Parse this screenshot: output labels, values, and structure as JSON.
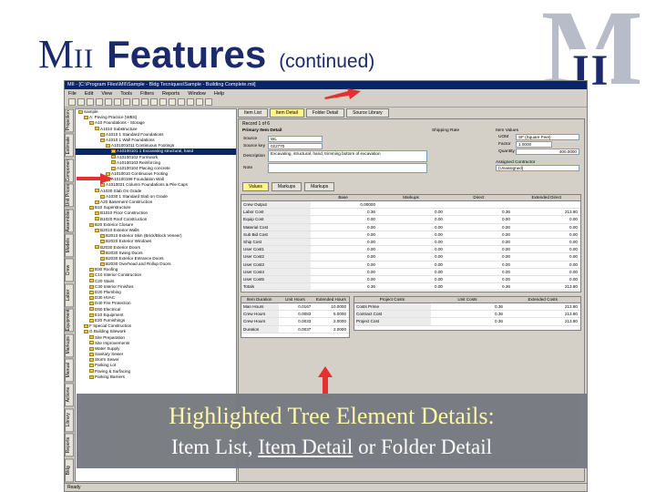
{
  "slide": {
    "title_m": "M",
    "title_ii": "II",
    "title_features": "Features",
    "title_continued": "(continued)",
    "logo_m": "M",
    "logo_ii": "II",
    "accent_color": "#1a2a6c",
    "arrow_color": "#e53030"
  },
  "app": {
    "window_title": "MII - [C:\\Program Files\\MII\\Sample - Bldg Tecniques\\Sample - Building Complete.mii]",
    "menu": [
      "File",
      "Edit",
      "View",
      "Tools",
      "Filters",
      "Reports",
      "Window",
      "Help"
    ],
    "left_tabs": [
      "Projection",
      "Estimate",
      "Components",
      "Unit Prices",
      "Assemblies",
      "Models",
      "Crew",
      "Labor",
      "Equipment",
      "Markups",
      "Manual",
      "Actions",
      "Library",
      "Reports",
      "Bldg"
    ],
    "tree": [
      "Sample",
      "A: Paving Practice (WBS)",
      "A10 Foundations - Storage",
      "A1010 Substructure",
      "A1010 1 Standard Foundations",
      "A1010 1 Wall Foundations",
      "A101001011 Continuous Footings",
      "A10100101 1 Excavating structural, hand",
      "A10100102 Formwork",
      "A10100103 Reinforcing",
      "A10100104 Placing concrete",
      "A1010010 Continuous Footing",
      "A10100199 Foundation Wall",
      "A1010021 Column Foundations & Pile Caps",
      "A1030 Slab On Grade",
      "A1030 1 Standard Slab on Grade",
      "A20 Basement Construction",
      "B10 Superstructure",
      "B1010 Floor Construction",
      "B1020 Roof Construction",
      "B20 Exterior Closure",
      "B2010 Exterior Walls",
      "B2010 Exterior Skin (Brick/Block Veneer)",
      "B2020 Exterior Windows",
      "B2030 Exterior Doors",
      "B2030 Swing Doors",
      "B2030 Exterior Entrance Doors",
      "B2030 Overhead and Rollup Doors",
      "B30 Roofing",
      "C10 Interior Construction",
      "C20 Stairs",
      "C30 Interior Finishes",
      "D20 Plumbing",
      "D30 HVAC",
      "D40 Fire Protection",
      "D50 Electrical",
      "E10 Equipment",
      "E20 Furnishings",
      "F Special Construction",
      "G Building Sitework",
      "Site Preparation",
      "Site Improvements",
      "Water Supply",
      "Sanitary Sewer",
      "Storm Sewer",
      "Parking Lot",
      "Paving & Surfacing",
      "Parking Barriers"
    ],
    "tree_selected_index": 7,
    "tabs": [
      "Item List",
      "Item Detail",
      "Folder Detail",
      "Source Library"
    ],
    "active_tab_index": 1,
    "record_label": "Record 1 of 6",
    "detail": {
      "section_label": "Primary Item Detail",
      "source_label": "Source",
      "source_value": "WL",
      "source_key_label": "Source key",
      "source_key_value": "022770",
      "description_label": "Description",
      "description_value": "Excavating, structural, hand, trimming bottom of excavation",
      "note_label": "Note",
      "quantity_label": "Quantity",
      "quantity_value": "400.0000",
      "uom_label": "UOM",
      "uom_value": "SF (Square Feet)",
      "factor_label": "Factor",
      "factor_value": "1.0000",
      "ship_rate_label": "Shipping Rate",
      "assigned_label": "Assigned Contractor",
      "assigned_value": "(Unassigned)",
      "item_values_label": "Item Values",
      "subtabs": [
        "Values",
        "Markups",
        "Markups"
      ]
    },
    "cost_grid": {
      "headers": [
        "",
        "Base",
        "Markups",
        "Direct",
        "Extended Direct"
      ],
      "rows": [
        {
          "name": "Crew Output",
          "base": "0.00000",
          "markup": "",
          "direct": "",
          "ext": ""
        },
        {
          "name": "Labor Cost",
          "base": "0.36",
          "markup": "0.00",
          "direct": "0.36",
          "ext": "213.80"
        },
        {
          "name": "Equip Cost",
          "base": "0.00",
          "markup": "0.00",
          "direct": "0.00",
          "ext": "0.00"
        },
        {
          "name": "Material Cost",
          "base": "0.00",
          "markup": "0.00",
          "direct": "0.00",
          "ext": "0.00"
        },
        {
          "name": "Sub Bid Cost",
          "base": "0.00",
          "markup": "0.00",
          "direct": "0.00",
          "ext": "0.00"
        },
        {
          "name": "Ship Cost",
          "base": "0.00",
          "markup": "0.00",
          "direct": "0.00",
          "ext": "0.00"
        },
        {
          "name": "User Cost1",
          "base": "0.00",
          "markup": "0.00",
          "direct": "0.00",
          "ext": "0.00"
        },
        {
          "name": "User Cost2",
          "base": "0.00",
          "markup": "0.00",
          "direct": "0.00",
          "ext": "0.00"
        },
        {
          "name": "User Cost3",
          "base": "0.00",
          "markup": "0.00",
          "direct": "0.00",
          "ext": "0.00"
        },
        {
          "name": "User Cost4",
          "base": "0.00",
          "markup": "0.00",
          "direct": "0.00",
          "ext": "0.00"
        },
        {
          "name": "User Cost5",
          "base": "0.00",
          "markup": "0.00",
          "direct": "0.00",
          "ext": "0.00"
        },
        {
          "name": "Totals",
          "base": "0.36",
          "markup": "0.00",
          "direct": "0.36",
          "ext": "213.80"
        }
      ]
    },
    "duration_grid": {
      "headers": [
        "Item Duration",
        "Unit Hours",
        "Extended Hours"
      ],
      "rows": [
        {
          "name": "Man Hours",
          "unit": "0.0167",
          "ext": "10.0000"
        },
        {
          "name": "Crew Hours",
          "unit": "0.0083",
          "ext": "5.0000"
        },
        {
          "name": "Crew Hours",
          "unit": "0.0033",
          "ext": "2.0000"
        },
        {
          "name": "Duration",
          "unit": "0.0037",
          "ext": "2.0000"
        }
      ]
    },
    "project_grid": {
      "headers": [
        "Project Costs",
        "Unit Costs",
        "Extended Costs"
      ],
      "rows": [
        {
          "name": "Costs Prime",
          "unit": "0.36",
          "ext": "213.80"
        },
        {
          "name": "Contract Cost",
          "unit": "0.36",
          "ext": "213.80"
        },
        {
          "name": "Project Cost",
          "unit": "0.36",
          "ext": "213.80"
        }
      ]
    },
    "status": "Ready"
  },
  "banner": {
    "line1": "Highlighted Tree Element Details:",
    "line2_part1": "Item List, ",
    "line2_underlined": "Item Detail",
    "line2_part2": " or Folder Detail",
    "line1_color": "#fff8a8",
    "background": "#777b81"
  }
}
